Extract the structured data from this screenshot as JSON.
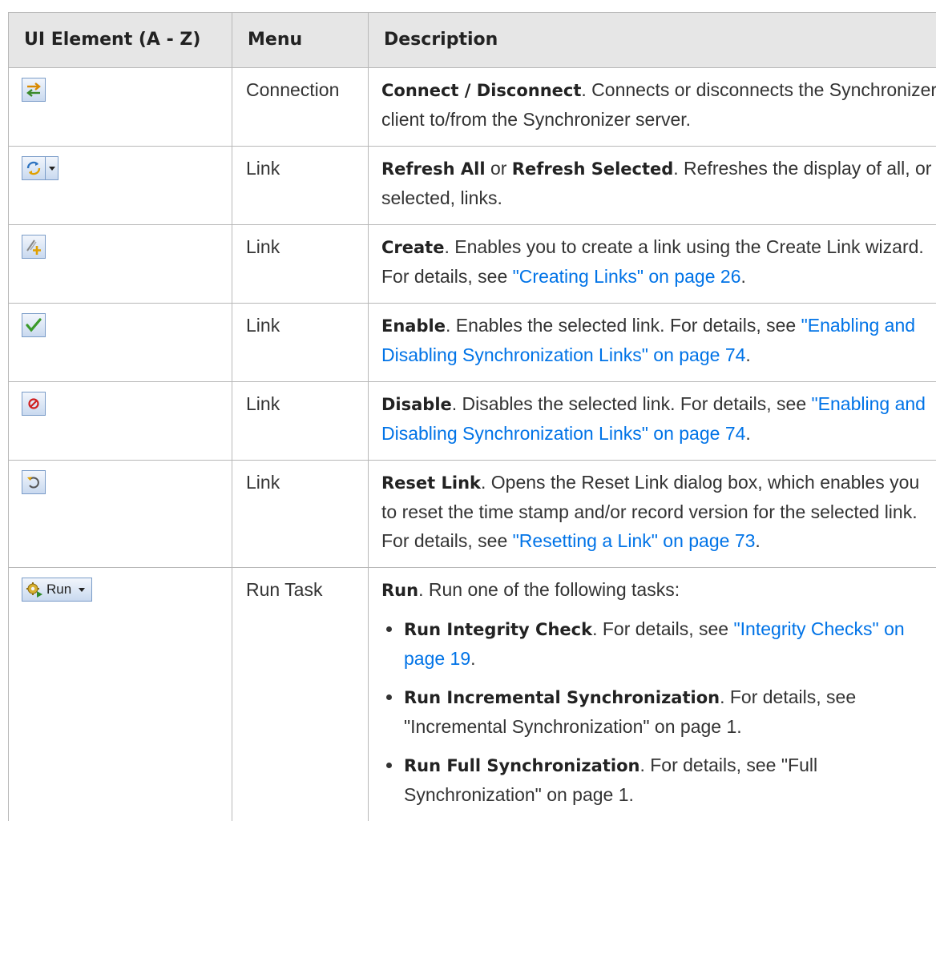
{
  "headers": [
    "UI Element (A - Z)",
    "Menu",
    "Description"
  ],
  "rows": [
    {
      "icon": "connect-disconnect-icon",
      "menu": "Connection",
      "title": "Connect / Disconnect",
      "text": ". Connects or disconnects the Synchronizer client to/from the Synchronizer server."
    },
    {
      "icon": "refresh-icon",
      "menu": "Link",
      "title": "Refresh All",
      "or": " or ",
      "title2": "Refresh Selected",
      "text": ". Refreshes the display of all, or selected, links."
    },
    {
      "icon": "create-link-icon",
      "menu": "Link",
      "title": "Create",
      "text": ". Enables you to create a link using the Create Link wizard. For details, see ",
      "link": "\"Creating Links\" on page 26",
      "end": "."
    },
    {
      "icon": "enable-check-icon",
      "menu": "Link",
      "title": "Enable",
      "text": ". Enables the selected link. For details, see ",
      "link": "\"Enabling and Disabling Synchronization Links\" on page 74",
      "end": "."
    },
    {
      "icon": "disable-icon",
      "menu": "Link",
      "title": "Disable",
      "text": ". Disables the selected link. For details, see ",
      "link": "\"Enabling and Disabling Synchronization Links\" on page 74",
      "end": "."
    },
    {
      "icon": "reset-link-icon",
      "menu": "Link",
      "title": "Reset Link",
      "text": ". Opens the Reset Link dialog box, which enables you to reset the time stamp and/or record version for the selected link. For details, see ",
      "link": "\"Resetting a Link\" on page 73",
      "end": "."
    },
    {
      "icon": "run-gear-icon",
      "run_label": "Run",
      "menu": "Run Task",
      "title": "Run",
      "text": ". Run one of the following tasks:",
      "bullets": [
        {
          "title": "Run Integrity Check",
          "text": ". For details, see ",
          "link": "\"Integrity Checks\" on page 19",
          "end": "."
        },
        {
          "title": "Run Incremental Synchronization",
          "text": ". For details, see \"Incremental Synchronization\" on page 1."
        },
        {
          "title": "Run Full Synchronization",
          "text": ". For details, see \"Full Synchronization\" on page 1."
        }
      ]
    }
  ]
}
